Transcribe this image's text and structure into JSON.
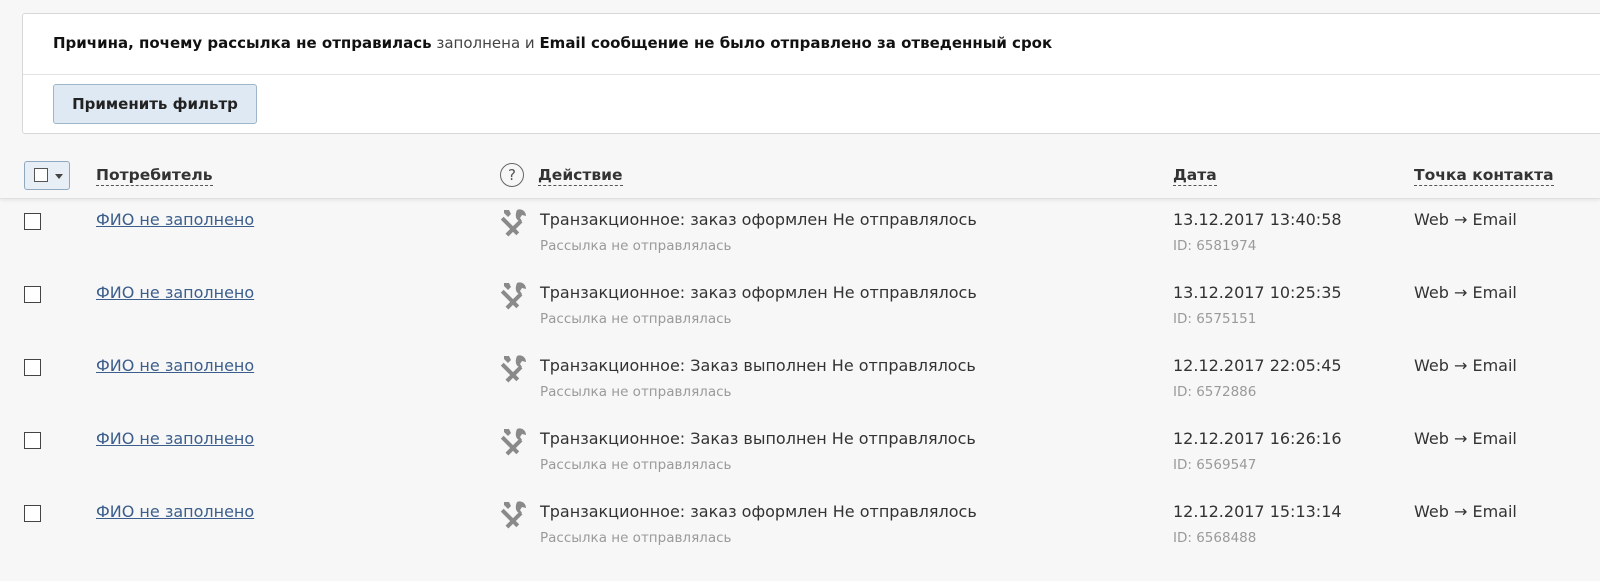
{
  "filter": {
    "part1": "Причина, почему рассылка не отправилась",
    "part2": " заполнена и ",
    "part3": "Email сообщение не было отправлено за отведенный срок",
    "apply_label": "Применить фильтр"
  },
  "columns": {
    "consumer": "Потребитель",
    "help_glyph": "?",
    "action": "Действие",
    "date": "Дата",
    "contact": "Точка контакта"
  },
  "rows": [
    {
      "consumer": "ФИО не заполнено",
      "icon": "tools-icon",
      "action": "Транзакционное: заказ оформлен Не отправлялось",
      "action_sub": "Рассылка не отправлялась",
      "date": "13.12.2017 13:40:58",
      "id": "ID: 6581974",
      "contact": "Web → Email"
    },
    {
      "consumer": "ФИО не заполнено",
      "icon": "tools-icon",
      "action": "Транзакционное: заказ оформлен Не отправлялось",
      "action_sub": "Рассылка не отправлялась",
      "date": "13.12.2017 10:25:35",
      "id": "ID: 6575151",
      "contact": "Web → Email"
    },
    {
      "consumer": "ФИО не заполнено",
      "icon": "tools-icon",
      "action": "Транзакционное: Заказ выполнен Не отправлялось",
      "action_sub": "Рассылка не отправлялась",
      "date": "12.12.2017 22:05:45",
      "id": "ID: 6572886",
      "contact": "Web → Email"
    },
    {
      "consumer": "ФИО не заполнено",
      "icon": "tools-icon",
      "action": "Транзакционное: Заказ выполнен Не отправлялось",
      "action_sub": "Рассылка не отправлялась",
      "date": "12.12.2017 16:26:16",
      "id": "ID: 6569547",
      "contact": "Web → Email"
    },
    {
      "consumer": "ФИО не заполнено",
      "icon": "tools-icon",
      "action": "Транзакционное: заказ оформлен Не отправлялось",
      "action_sub": "Рассылка не отправлялась",
      "date": "12.12.2017 15:13:14",
      "id": "ID: 6568488",
      "contact": "Web → Email"
    }
  ],
  "colors": {
    "link": "#3b5e8c",
    "button_bg": "#dfe9f3",
    "muted_text": "#9a9a9a"
  }
}
